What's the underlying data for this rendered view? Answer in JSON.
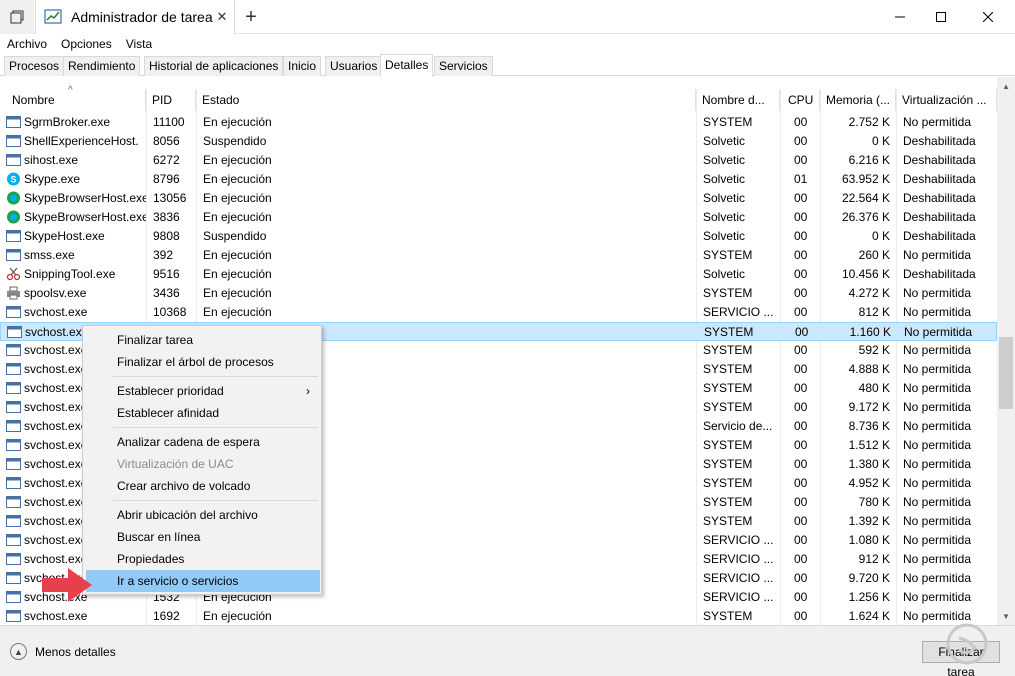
{
  "window": {
    "title": "Administrador de tarea",
    "new_tab": "+",
    "close_tab": "✕"
  },
  "menu": [
    "Archivo",
    "Opciones",
    "Vista"
  ],
  "tabs": [
    {
      "label": "Procesos",
      "active": false
    },
    {
      "label": "Rendimiento",
      "active": false
    },
    {
      "label": "Historial de aplicaciones",
      "active": false
    },
    {
      "label": "Inicio",
      "active": false
    },
    {
      "label": "Usuarios",
      "active": false
    },
    {
      "label": "Detalles",
      "active": true
    },
    {
      "label": "Servicios",
      "active": false
    }
  ],
  "columns": {
    "name": "Nombre",
    "pid": "PID",
    "status": "Estado",
    "user": "Nombre d...",
    "cpu": "CPU",
    "memory": "Memoria (...",
    "virt": "Virtualización ..."
  },
  "rows": [
    {
      "name": "SgrmBroker.exe",
      "pid": "11100",
      "status": "En ejecución",
      "user": "SYSTEM",
      "cpu": "00",
      "memory": "2.752 K",
      "virt": "No permitida",
      "icon": "window-icon"
    },
    {
      "name": "ShellExperienceHost.",
      "pid": "8056",
      "status": "Suspendido",
      "user": "Solvetic",
      "cpu": "00",
      "memory": "0 K",
      "virt": "Deshabilitada",
      "icon": "window-icon"
    },
    {
      "name": "sihost.exe",
      "pid": "6272",
      "status": "En ejecución",
      "user": "Solvetic",
      "cpu": "00",
      "memory": "6.216 K",
      "virt": "Deshabilitada",
      "icon": "window-icon"
    },
    {
      "name": "Skype.exe",
      "pid": "8796",
      "status": "En ejecución",
      "user": "Solvetic",
      "cpu": "01",
      "memory": "63.952 K",
      "virt": "Deshabilitada",
      "icon": "skype-icon"
    },
    {
      "name": "SkypeBrowserHost.exe",
      "pid": "13056",
      "status": "En ejecución",
      "user": "Solvetic",
      "cpu": "00",
      "memory": "22.564 K",
      "virt": "Deshabilitada",
      "icon": "skype-browser-icon"
    },
    {
      "name": "SkypeBrowserHost.exe",
      "pid": "3836",
      "status": "En ejecución",
      "user": "Solvetic",
      "cpu": "00",
      "memory": "26.376 K",
      "virt": "Deshabilitada",
      "icon": "skype-browser-icon"
    },
    {
      "name": "SkypeHost.exe",
      "pid": "9808",
      "status": "Suspendido",
      "user": "Solvetic",
      "cpu": "00",
      "memory": "0 K",
      "virt": "Deshabilitada",
      "icon": "window-icon"
    },
    {
      "name": "smss.exe",
      "pid": "392",
      "status": "En ejecución",
      "user": "SYSTEM",
      "cpu": "00",
      "memory": "260 K",
      "virt": "No permitida",
      "icon": "window-icon"
    },
    {
      "name": "SnippingTool.exe",
      "pid": "9516",
      "status": "En ejecución",
      "user": "Solvetic",
      "cpu": "00",
      "memory": "10.456 K",
      "virt": "Deshabilitada",
      "icon": "scissors-icon"
    },
    {
      "name": "spoolsv.exe",
      "pid": "3436",
      "status": "En ejecución",
      "user": "SYSTEM",
      "cpu": "00",
      "memory": "4.272 K",
      "virt": "No permitida",
      "icon": "printer-icon"
    },
    {
      "name": "svchost.exe",
      "pid": "10368",
      "status": "En ejecución",
      "user": "SERVICIO ...",
      "cpu": "00",
      "memory": "812 K",
      "virt": "No permitida",
      "icon": "window-icon"
    },
    {
      "name": "svchost.exe",
      "pid": "",
      "status": "",
      "user": "SYSTEM",
      "cpu": "00",
      "memory": "1.160 K",
      "virt": "No permitida",
      "icon": "window-icon",
      "selected": true
    },
    {
      "name": "svchost.exe",
      "pid": "",
      "status": "",
      "user": "SYSTEM",
      "cpu": "00",
      "memory": "592 K",
      "virt": "No permitida",
      "icon": "window-icon"
    },
    {
      "name": "svchost.exe",
      "pid": "",
      "status": "",
      "user": "SYSTEM",
      "cpu": "00",
      "memory": "4.888 K",
      "virt": "No permitida",
      "icon": "window-icon"
    },
    {
      "name": "svchost.exe",
      "pid": "",
      "status": "",
      "user": "SYSTEM",
      "cpu": "00",
      "memory": "480 K",
      "virt": "No permitida",
      "icon": "window-icon"
    },
    {
      "name": "svchost.exe",
      "pid": "",
      "status": "",
      "user": "SYSTEM",
      "cpu": "00",
      "memory": "9.172 K",
      "virt": "No permitida",
      "icon": "window-icon"
    },
    {
      "name": "svchost.exe",
      "pid": "",
      "status": "",
      "user": "Servicio de...",
      "cpu": "00",
      "memory": "8.736 K",
      "virt": "No permitida",
      "icon": "window-icon"
    },
    {
      "name": "svchost.exe",
      "pid": "",
      "status": "",
      "user": "SYSTEM",
      "cpu": "00",
      "memory": "1.512 K",
      "virt": "No permitida",
      "icon": "window-icon"
    },
    {
      "name": "svchost.exe",
      "pid": "",
      "status": "",
      "user": "SYSTEM",
      "cpu": "00",
      "memory": "1.380 K",
      "virt": "No permitida",
      "icon": "window-icon"
    },
    {
      "name": "svchost.exe",
      "pid": "",
      "status": "",
      "user": "SYSTEM",
      "cpu": "00",
      "memory": "4.952 K",
      "virt": "No permitida",
      "icon": "window-icon"
    },
    {
      "name": "svchost.exe",
      "pid": "",
      "status": "",
      "user": "SYSTEM",
      "cpu": "00",
      "memory": "780 K",
      "virt": "No permitida",
      "icon": "window-icon"
    },
    {
      "name": "svchost.exe",
      "pid": "",
      "status": "",
      "user": "SYSTEM",
      "cpu": "00",
      "memory": "1.392 K",
      "virt": "No permitida",
      "icon": "window-icon"
    },
    {
      "name": "svchost.exe",
      "pid": "",
      "status": "",
      "user": "SERVICIO ...",
      "cpu": "00",
      "memory": "1.080 K",
      "virt": "No permitida",
      "icon": "window-icon"
    },
    {
      "name": "svchost.exe",
      "pid": "",
      "status": "",
      "user": "SERVICIO ...",
      "cpu": "00",
      "memory": "912 K",
      "virt": "No permitida",
      "icon": "window-icon"
    },
    {
      "name": "svchost.exe",
      "pid": "",
      "status": "",
      "user": "SERVICIO ...",
      "cpu": "00",
      "memory": "9.720 K",
      "virt": "No permitida",
      "icon": "window-icon"
    },
    {
      "name": "svchost.exe",
      "pid": "1532",
      "status": "En ejecución",
      "user": "SERVICIO ...",
      "cpu": "00",
      "memory": "1.256 K",
      "virt": "No permitida",
      "icon": "window-icon"
    },
    {
      "name": "svchost.exe",
      "pid": "1692",
      "status": "En ejecución",
      "user": "SYSTEM",
      "cpu": "00",
      "memory": "1.624 K",
      "virt": "No permitida",
      "icon": "window-icon"
    }
  ],
  "context_menu": [
    {
      "label": "Finalizar tarea",
      "disabled": false
    },
    {
      "label": "Finalizar el árbol de procesos",
      "disabled": false
    },
    {
      "separator": true
    },
    {
      "label": "Establecer prioridad",
      "disabled": false,
      "submenu": true
    },
    {
      "label": "Establecer afinidad",
      "disabled": false
    },
    {
      "separator": true
    },
    {
      "label": "Analizar cadena de espera",
      "disabled": false
    },
    {
      "label": "Virtualización de UAC",
      "disabled": true
    },
    {
      "label": "Crear archivo de volcado",
      "disabled": false
    },
    {
      "separator": true
    },
    {
      "label": "Abrir ubicación del archivo",
      "disabled": false
    },
    {
      "label": "Buscar en línea",
      "disabled": false
    },
    {
      "label": "Propiedades",
      "disabled": false
    },
    {
      "label": "Ir a servicio o servicios",
      "disabled": false,
      "highlighted": true
    }
  ],
  "footer": {
    "less_details": "Menos detalles",
    "end_task": "Finalizar tarea"
  },
  "colors": {
    "selection": "#cce8ff",
    "menu_highlight": "#91c9f7",
    "annotation_arrow": "#e8404a"
  }
}
